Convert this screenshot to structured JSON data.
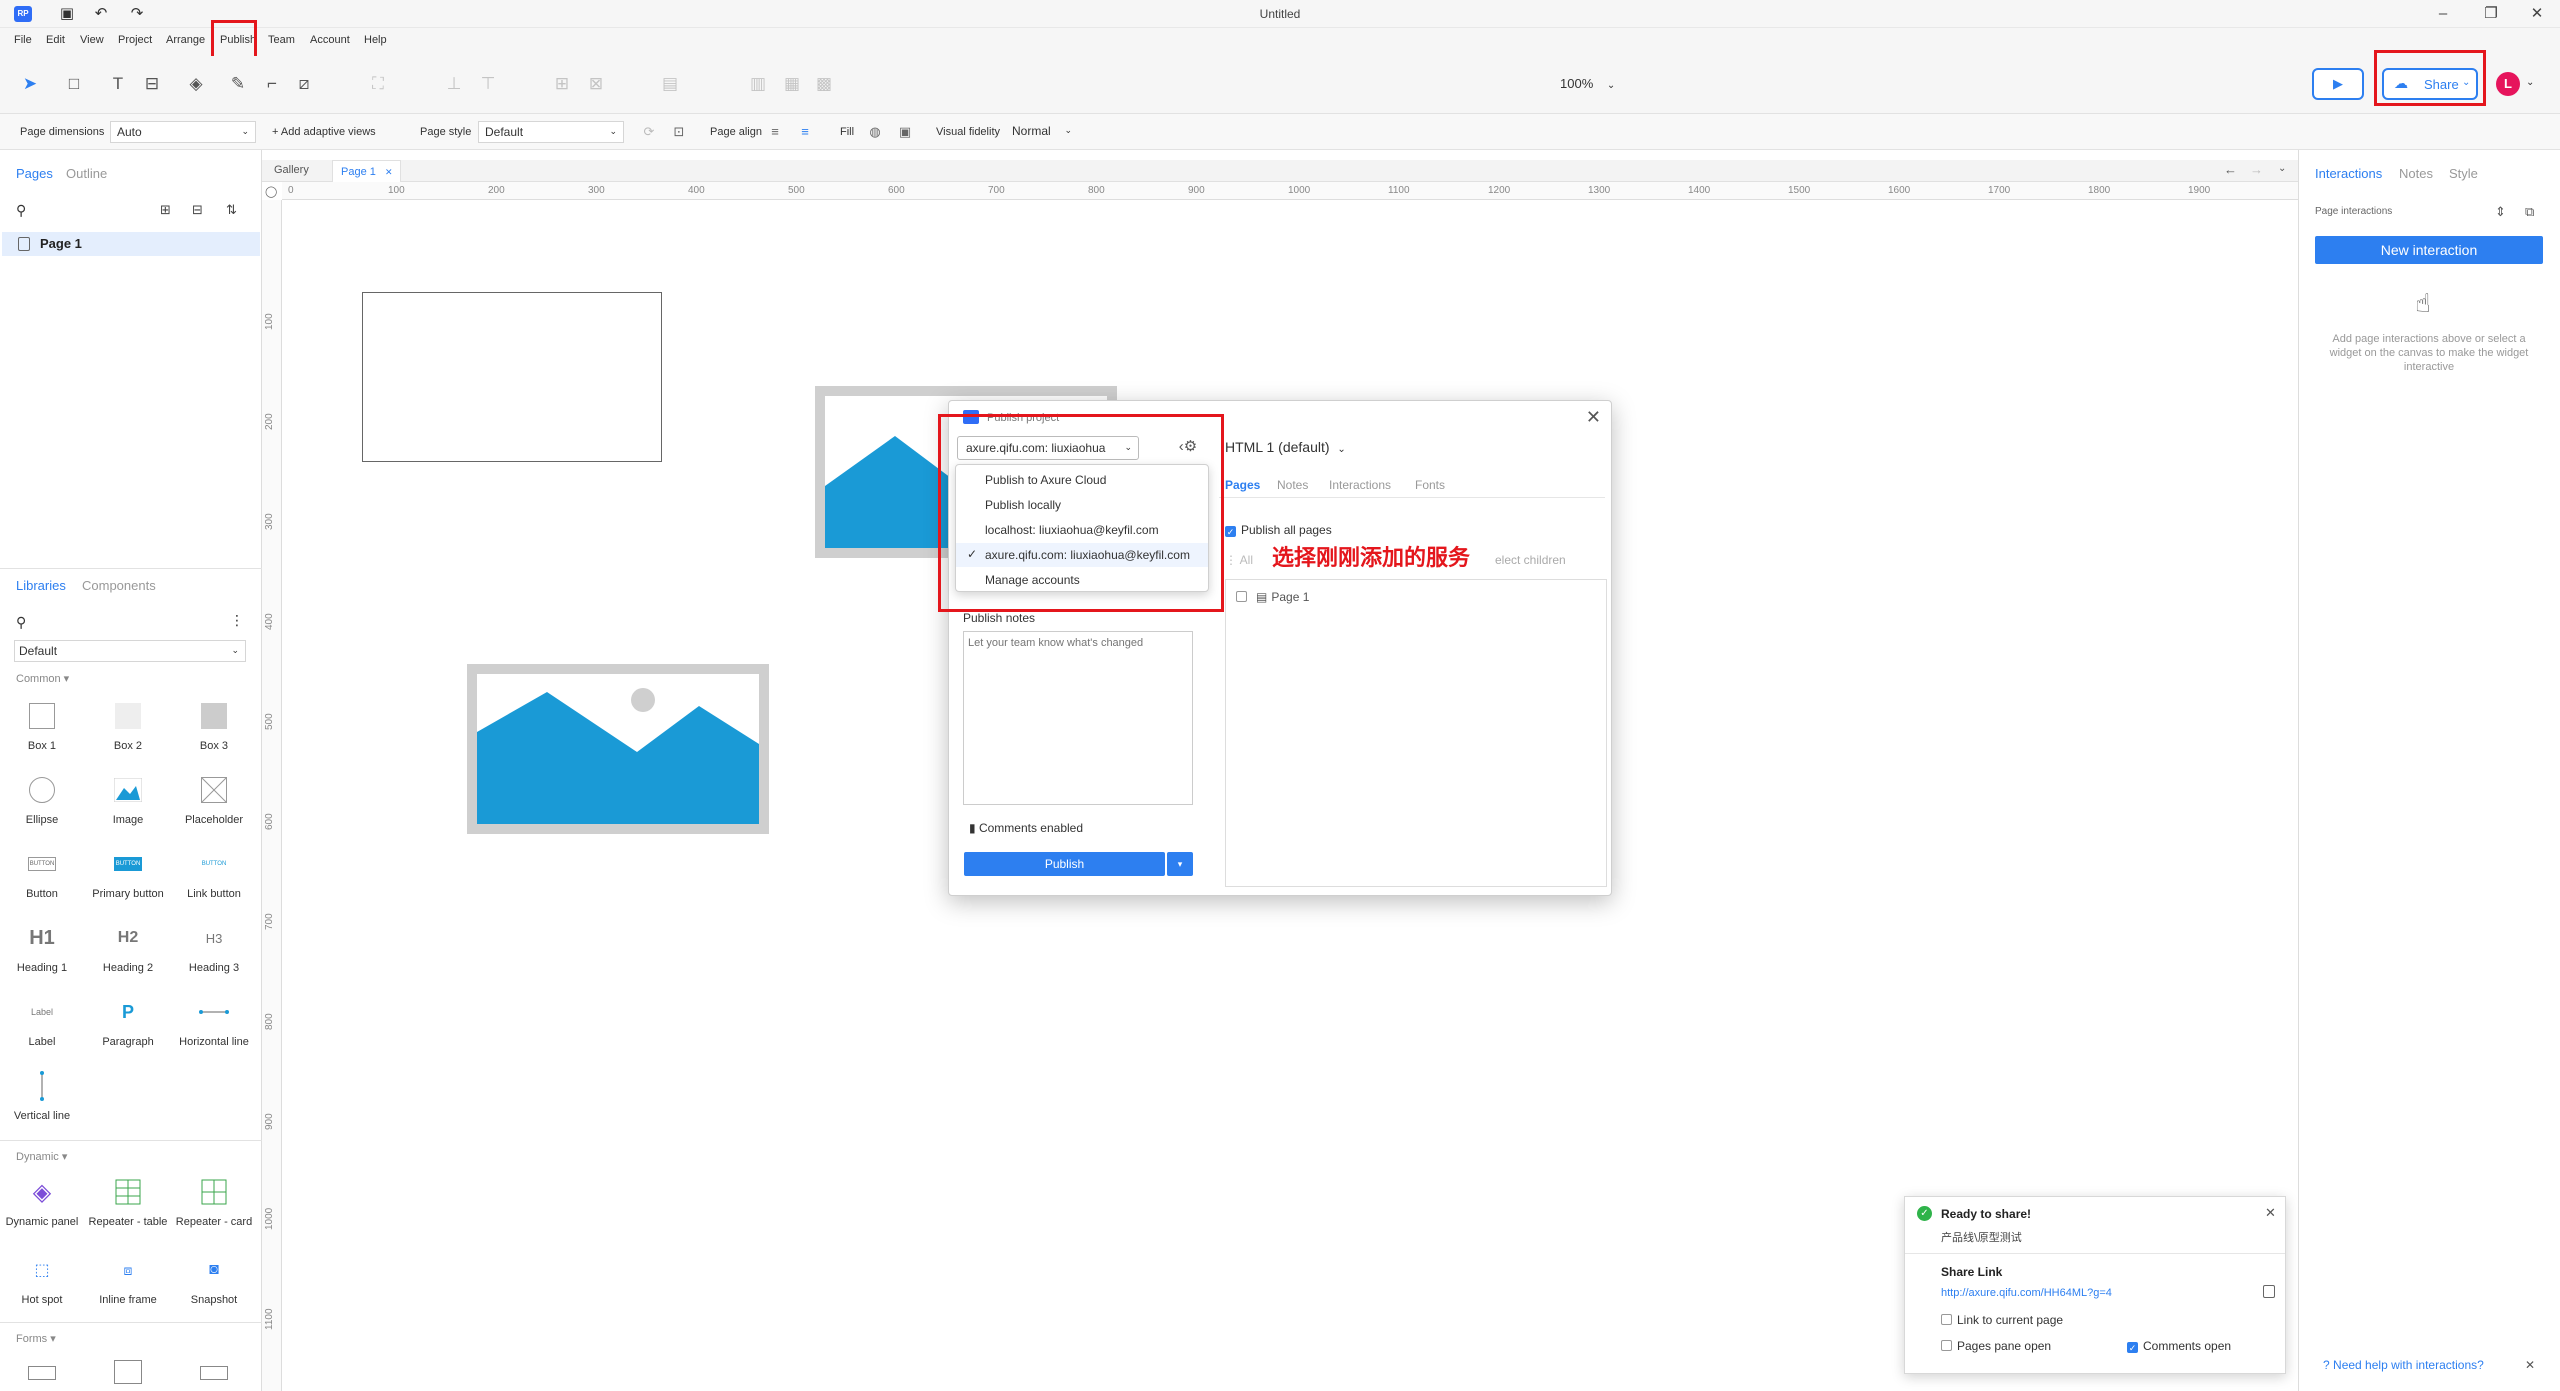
{
  "window": {
    "title": "Untitled"
  },
  "menu": [
    "File",
    "Edit",
    "View",
    "Project",
    "Arrange",
    "Publish",
    "Team",
    "Account",
    "Help"
  ],
  "toolbar": {
    "zoom": "100%",
    "share_label": "Share",
    "avatar_initial": "L"
  },
  "stylebar": {
    "page_dimensions_label": "Page dimensions",
    "page_dimensions_value": "Auto",
    "adaptive_views": "+ Add adaptive views",
    "page_style_label": "Page style",
    "page_style_value": "Default",
    "page_align_label": "Page align",
    "fill_label": "Fill",
    "visual_fidelity_label": "Visual fidelity",
    "visual_fidelity_value": "Normal"
  },
  "left_panel": {
    "tabs": [
      "Pages",
      "Outline"
    ],
    "pages": [
      "Page 1"
    ],
    "lib_tabs": [
      "Libraries",
      "Components"
    ],
    "library_select": "Default",
    "sections": {
      "common": "Common ▾",
      "dynamic": "Dynamic ▾",
      "forms": "Forms ▾"
    },
    "common_widgets": [
      "Box 1",
      "Box 2",
      "Box 3",
      "Ellipse",
      "Image",
      "Placeholder",
      "Button",
      "Primary button",
      "Link button",
      "Heading 1",
      "Heading 2",
      "Heading 3",
      "Label",
      "Paragraph",
      "Horizontal line",
      "Vertical line"
    ],
    "dynamic_widgets": [
      "Dynamic panel",
      "Repeater - table",
      "Repeater - card",
      "Hot spot",
      "Inline frame",
      "Snapshot"
    ],
    "heading_glyphs": [
      "H1",
      "H2",
      "H3"
    ],
    "button_glyph": "BUTTON",
    "label_glyph": "Label"
  },
  "canvas": {
    "tabs": [
      "Gallery",
      "Page 1"
    ],
    "ruler_h": [
      "0",
      "100",
      "200",
      "300",
      "400",
      "500",
      "600",
      "700",
      "800",
      "900",
      "1000",
      "1100",
      "1200",
      "1300",
      "1400",
      "1500",
      "1600",
      "1700",
      "1800",
      "1900"
    ],
    "ruler_v": [
      "100",
      "200",
      "300",
      "400",
      "500",
      "600",
      "700",
      "800",
      "900",
      "1000",
      "1100"
    ]
  },
  "dialog": {
    "title": "Publish project",
    "server_value": "axure.qifu.com: liuxiaohua",
    "menu_items": [
      "Publish to Axure Cloud",
      "Publish locally",
      "localhost: liuxiaohua@keyfil.com",
      "axure.qifu.com: liuxiaohua@keyfil.com",
      "Manage accounts"
    ],
    "checked_index": 3,
    "notes_label": "Publish notes",
    "notes_placeholder": "Let your team know what's changed",
    "comments_enabled": "Comments enabled",
    "publish_label": "Publish",
    "format_select": "HTML 1 (default)",
    "tabs": [
      "Pages",
      "Notes",
      "Interactions",
      "Fonts"
    ],
    "publish_all_pages": "Publish all pages",
    "all_label": "All",
    "select_children": "elect children",
    "page_item": "Page 1"
  },
  "annotation": "选择刚刚添加的服务",
  "right_panel": {
    "tabs": [
      "Interactions",
      "Notes",
      "Style"
    ],
    "page_interactions": "Page interactions",
    "new_interaction": "New interaction",
    "hint": "Add page interactions above or select a widget on the canvas to make the widget interactive",
    "help": "Need help with interactions?"
  },
  "toast": {
    "title": "Ready to share!",
    "project": "产品线\\原型测试",
    "share_link_label": "Share Link",
    "link": "http://axure.qifu.com/HH64ML?g=4",
    "link_to_current": "Link to current page",
    "pages_pane_open": "Pages pane open",
    "comments_open": "Comments open"
  },
  "colors": {
    "accent": "#2d7ff0",
    "highlight": "#e4161c",
    "image_fill": "#1a9ad6"
  }
}
